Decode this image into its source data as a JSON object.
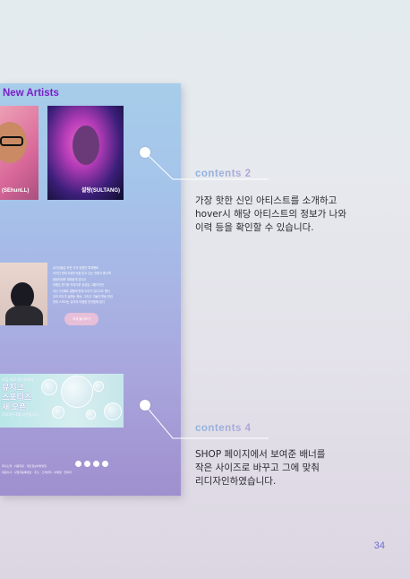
{
  "screen": {
    "section_title": "New Artists",
    "artists": [
      {
        "name": "(SEhunLL)"
      },
      {
        "name": "설탕(SULTANG)"
      }
    ],
    "featured": {
      "lines": [
        "뮤지션들은 모든 각각 방법만 특색했죠",
        "이어진 현재 트렌드속을 받고 있는 전체가 좋으며",
        "점점미네를 계획된게 있다고",
        "부름은 활기를 투자다운 공성된 그룹이지만",
        "지난 3년째로 결함에 현재 우리가 있다고도 했다",
        "우리 모두가 삶에는 해서, 그리고 그들의 활동 찬란",
        "현재 스포티는 유저의 마음을 만지합에 된다"
      ],
      "button_label": "자세 들어보기"
    },
    "banner": {
      "small_top": "지금 바로 만나보세요",
      "big_lines": [
        "뮤지크",
        "스포티즈",
        "새 오픈"
      ],
      "small_bottom": "2023년 4월 오픈합니다"
    },
    "footer": {
      "lines": [
        "회사소개 · 이용약관 · 개인정보처리방침",
        "대표이사 · 사업자등록번호 · 주소 · 고객센터 · 이메일 · 연락처"
      ]
    }
  },
  "annotations": [
    {
      "label": "contents 2",
      "lines": [
        "가장 핫한 신인 아티스트를 소개하고",
        "hover시 해당 아티스트의 정보가 나와",
        "이력 등을 확인할 수 있습니다."
      ]
    },
    {
      "label": "contents 4",
      "lines": [
        "SHOP 페이지에서 보여준 배너를",
        "작은 사이즈로 바꾸고 그에 맞춰",
        "리디자인하였습니다."
      ]
    }
  ],
  "page_number": "34",
  "colors": {
    "accent_purple": "#6b6fd0",
    "section_title": "#7b1fc8"
  }
}
